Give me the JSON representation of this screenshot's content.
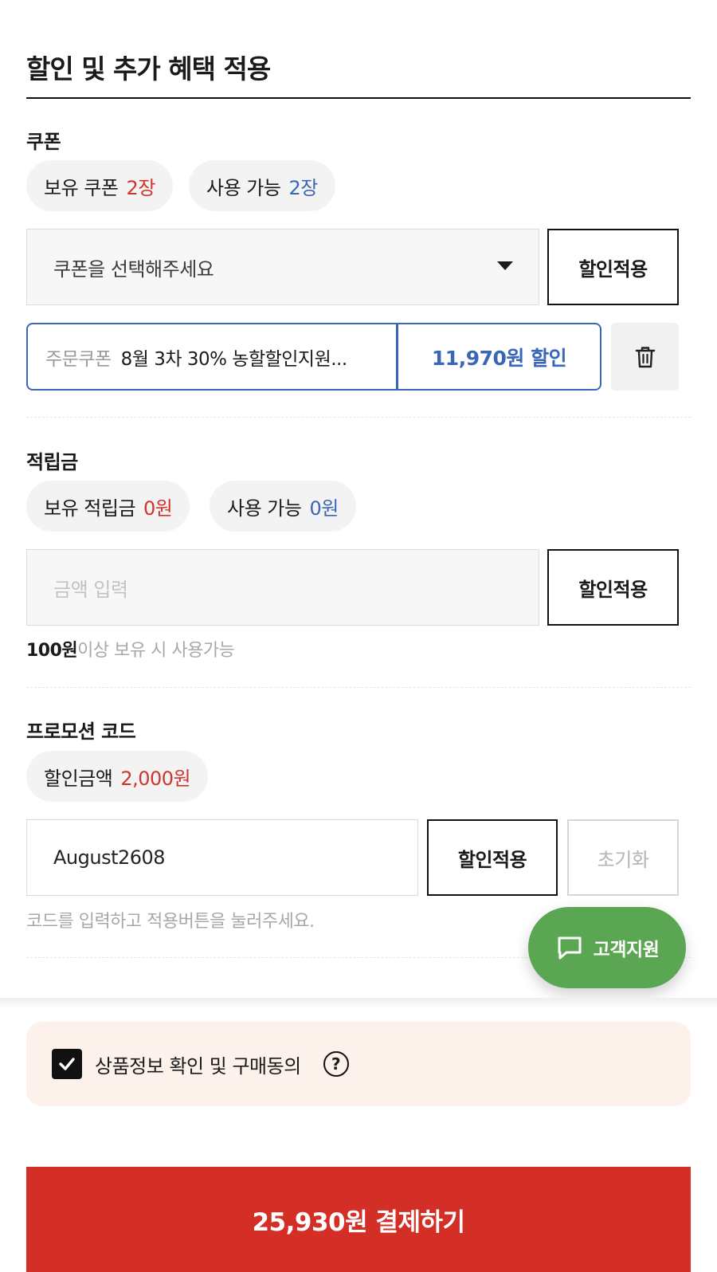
{
  "header": {
    "title": "할인 및 추가 혜택 적용"
  },
  "coupon": {
    "title": "쿠폰",
    "held_label": "보유 쿠폰",
    "held_value": "2장",
    "available_label": "사용 가능",
    "available_value": "2장",
    "select_placeholder": "쿠폰을 선택해주세요",
    "apply_label": "할인적용",
    "applied": {
      "type_label": "주문쿠폰",
      "name": "8월 3차 30% 농할할인지원...",
      "discount": "11,970원 할인",
      "delete_icon": "trash-icon"
    }
  },
  "points": {
    "title": "적립금",
    "held_label": "보유 적립금",
    "held_value": "0원",
    "available_label": "사용 가능",
    "available_value": "0원",
    "input_placeholder": "금액 입력",
    "apply_label": "할인적용",
    "hint_bold": "100원",
    "hint_rest": "이상 보유 시 사용가능"
  },
  "promo": {
    "title": "프로모션 코드",
    "discount_label": "할인금액",
    "discount_value": "2,000원",
    "code_value": "August2608",
    "apply_label": "할인적용",
    "reset_label": "초기화",
    "hint": "코드를 입력하고 적용버튼을 눌러주세요."
  },
  "support": {
    "label": "고객지원",
    "icon": "chat-icon"
  },
  "agreement": {
    "label": "상품정보 확인 및 구매동의",
    "checked": true,
    "help_symbol": "?"
  },
  "checkout": {
    "label": "25,930원 결제하기"
  },
  "colors": {
    "accent_red": "#d32f26",
    "accent_blue": "#3a66b7",
    "support_green": "#5aa653"
  }
}
